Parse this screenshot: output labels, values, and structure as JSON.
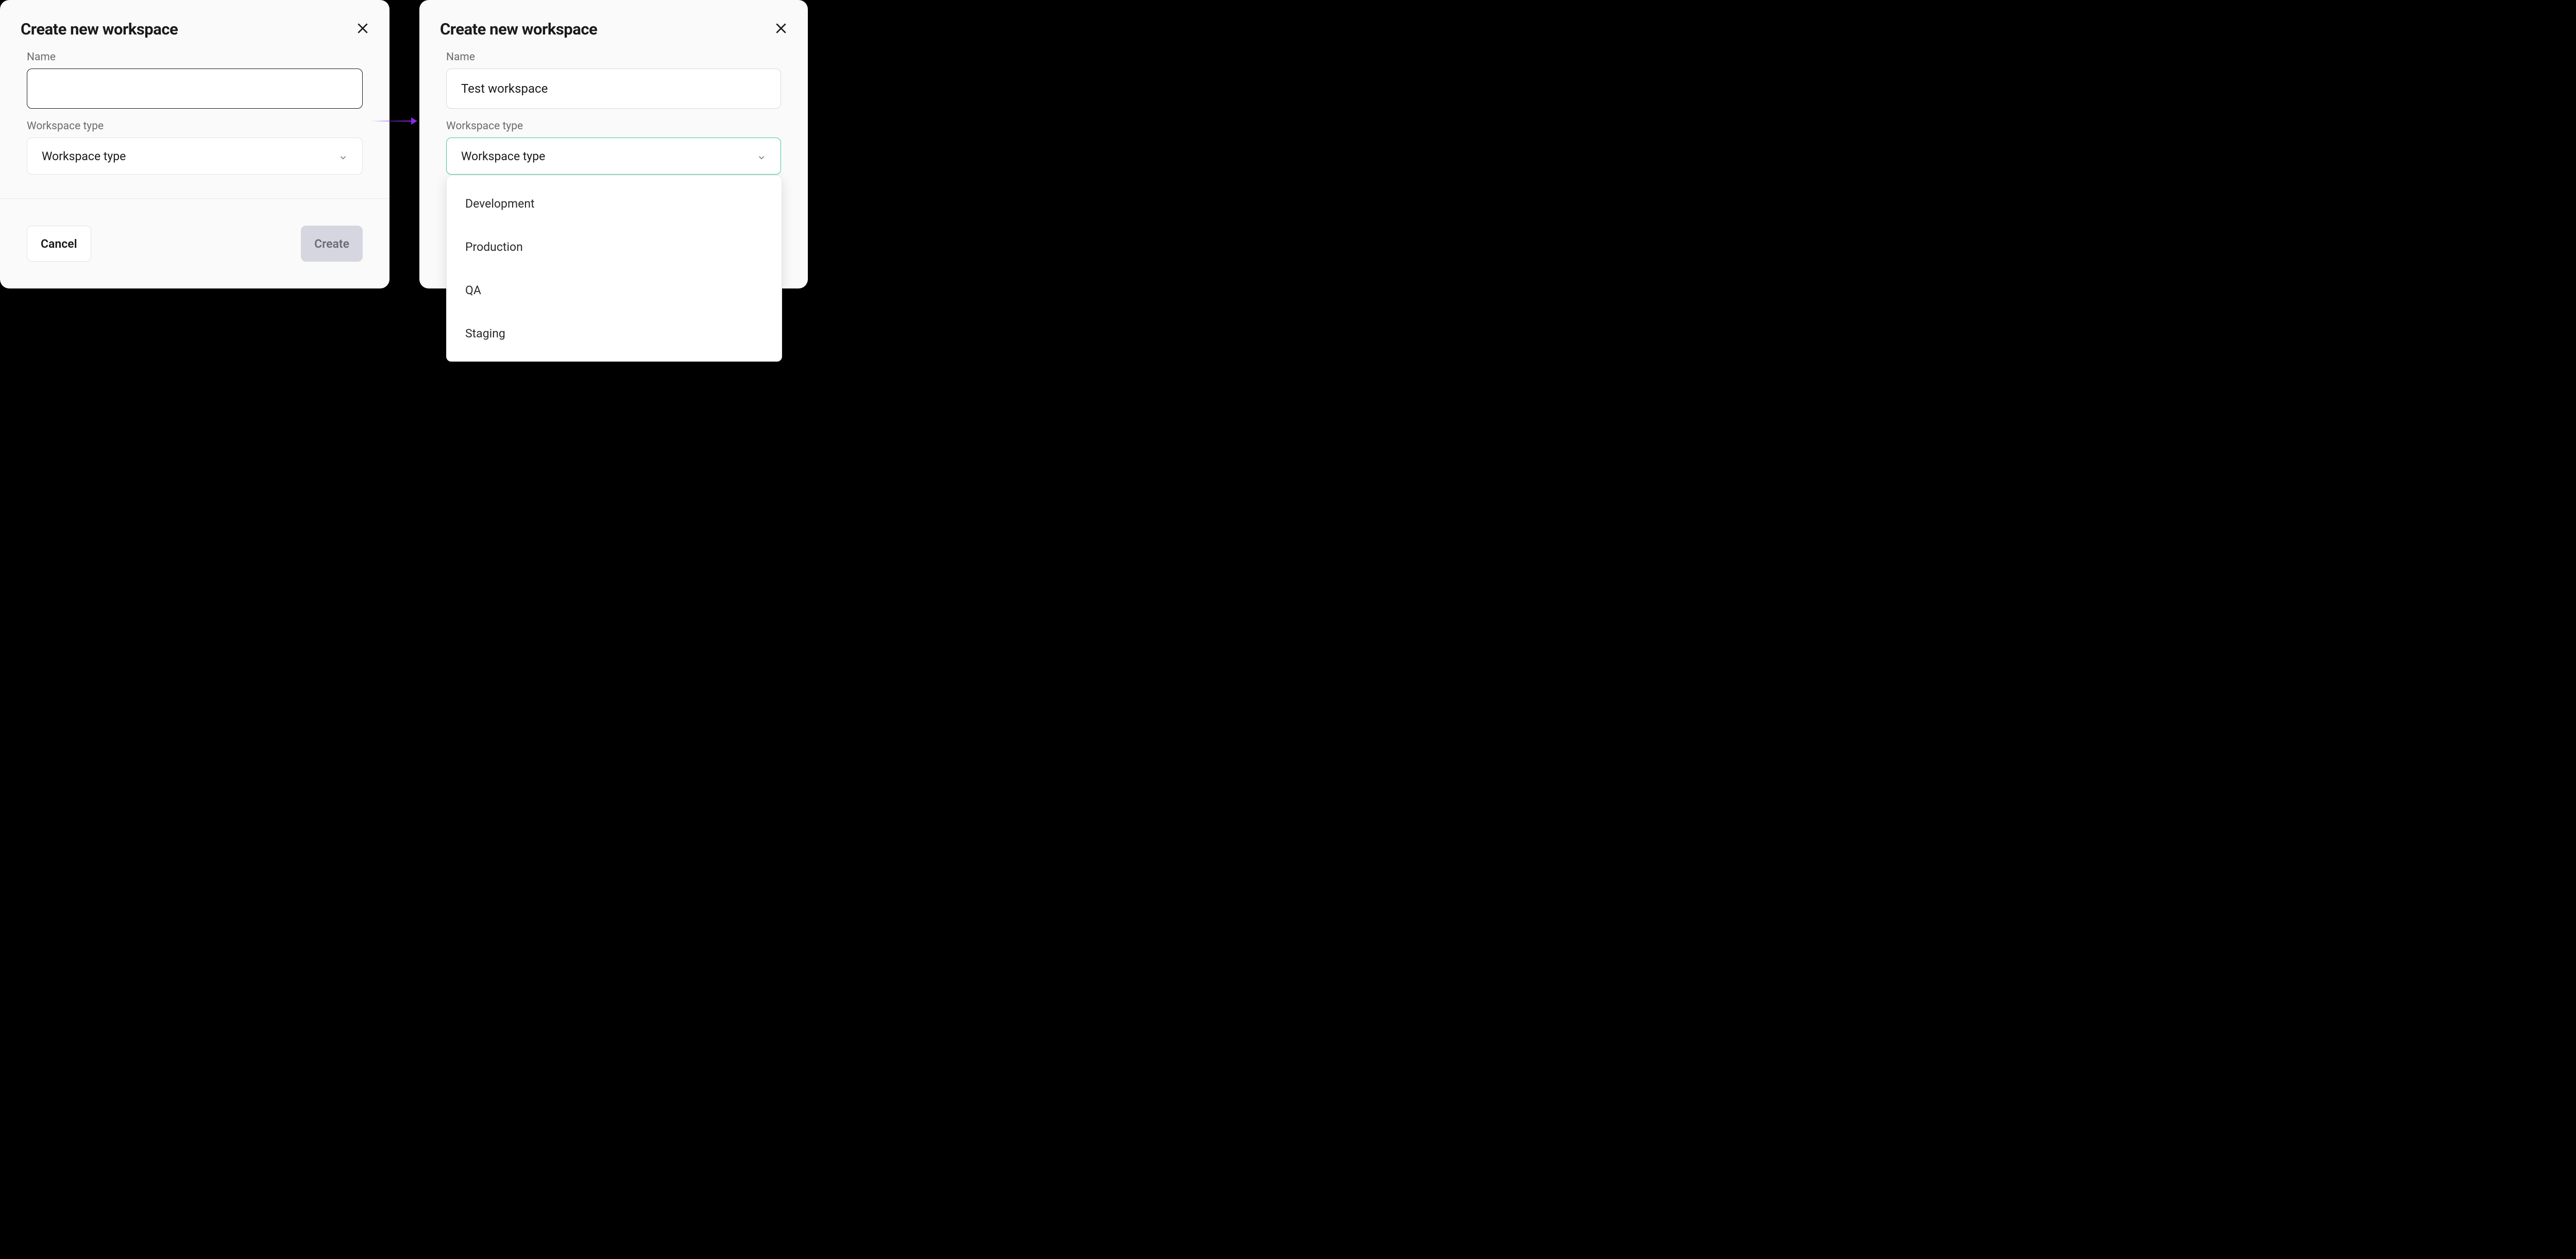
{
  "left_dialog": {
    "title": "Create new workspace",
    "name_label": "Name",
    "name_value": "",
    "type_label": "Workspace type",
    "type_placeholder": "Workspace type",
    "cancel_label": "Cancel",
    "create_label": "Create"
  },
  "right_dialog": {
    "title": "Create new workspace",
    "name_label": "Name",
    "name_value": "Test workspace",
    "type_label": "Workspace type",
    "type_placeholder": "Workspace type",
    "dropdown_options": [
      {
        "label": "Development"
      },
      {
        "label": "Production"
      },
      {
        "label": "QA"
      },
      {
        "label": "Staging"
      }
    ]
  },
  "colors": {
    "accent_green": "#3dc78f",
    "arrow_purple": "#8a2be2",
    "disabled_bg": "#d6d6e0"
  }
}
